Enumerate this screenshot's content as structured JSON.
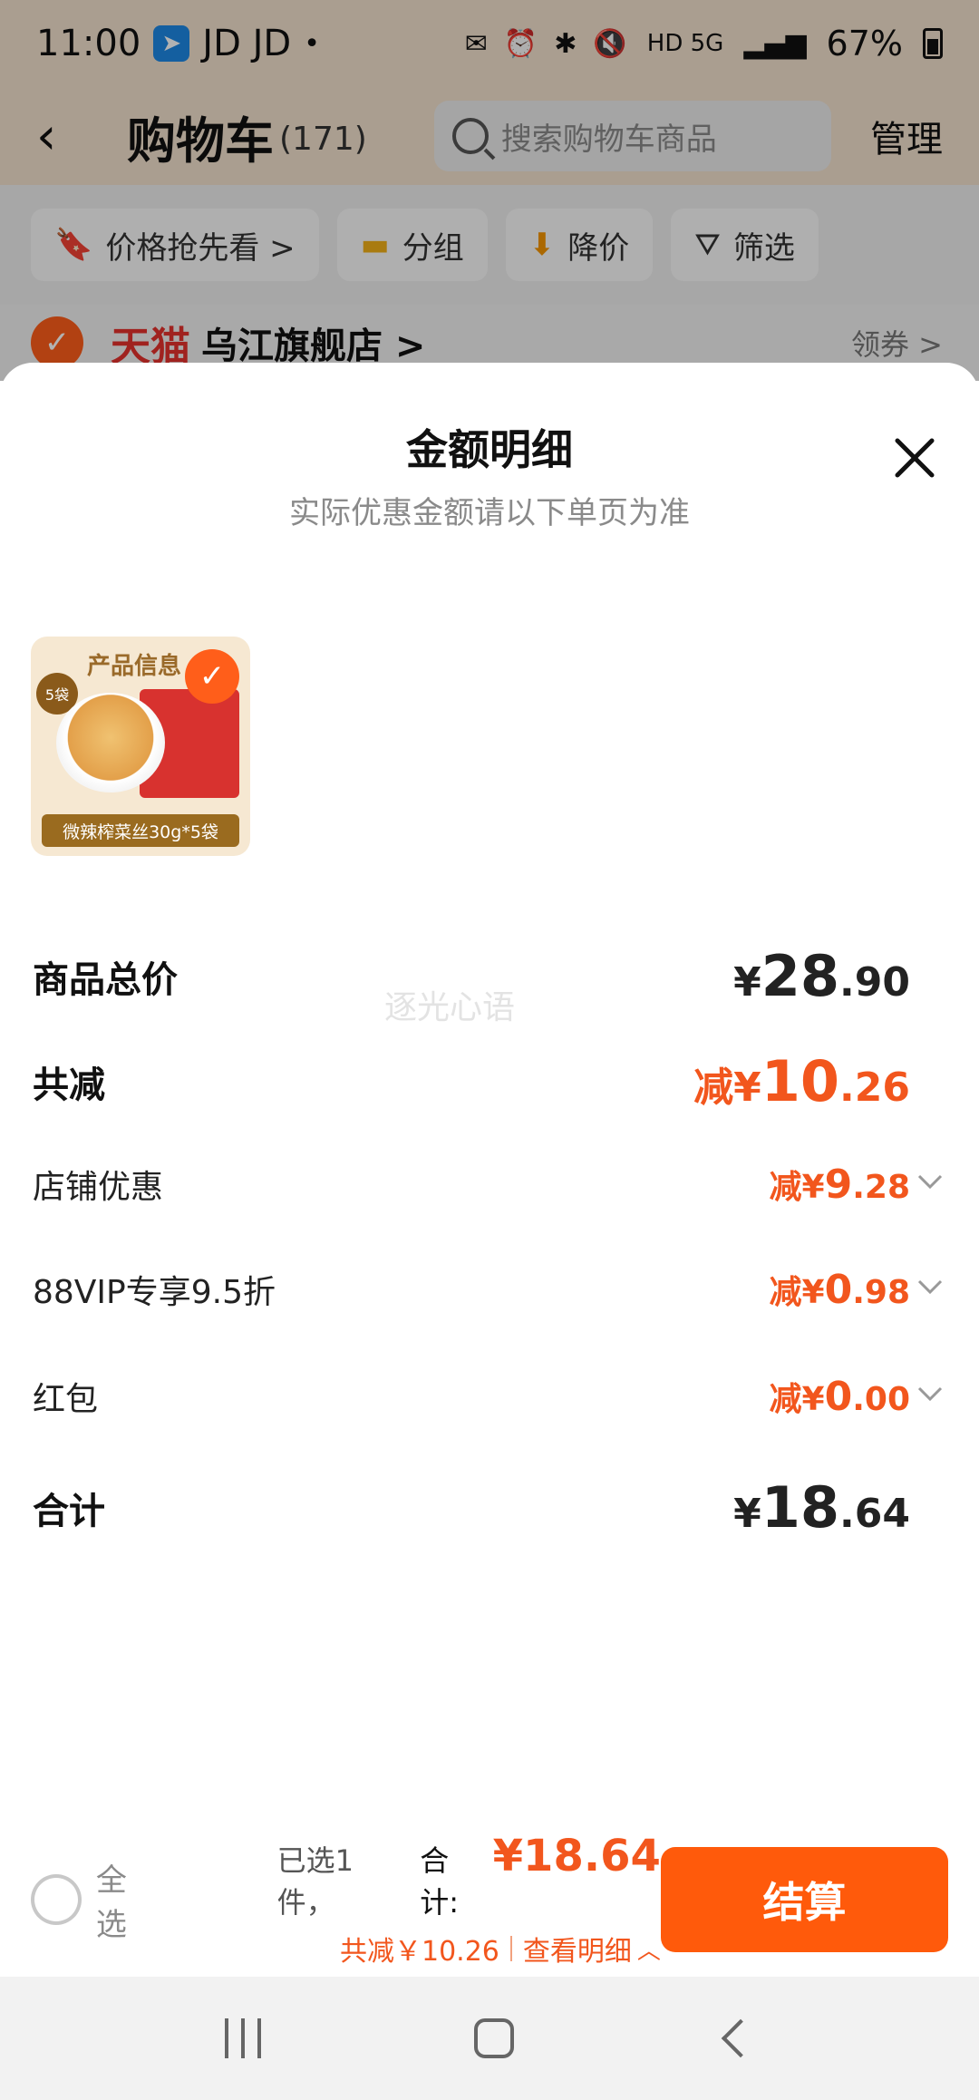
{
  "status_bar": {
    "time": "11:00",
    "app_labels": "JD JD",
    "dot": "•",
    "network": "HD 5G",
    "battery_pct": "67%"
  },
  "header": {
    "title": "购物车",
    "count": "(171)",
    "search_placeholder": "搜索购物车商品",
    "manage": "管理"
  },
  "filters": [
    {
      "label": "价格抢先看 >",
      "icon": "price-tag-icon"
    },
    {
      "label": "分组",
      "icon": "folder-icon"
    },
    {
      "label": "降价",
      "icon": "down-arrow-icon"
    },
    {
      "label": "筛选",
      "icon": "filter-icon"
    }
  ],
  "store": {
    "platform_logo": "天猫",
    "name": "乌江旗舰店 >",
    "coupon": "领券 >"
  },
  "sheet": {
    "title": "金额明细",
    "subtitle": "实际优惠金额请以下单页为准",
    "watermark": "逐光心语",
    "product": {
      "title": "产品信息",
      "badge": "5袋",
      "label": "微辣榨菜丝30g*5袋"
    },
    "rows": {
      "subtotal": {
        "label": "商品总价",
        "currency": "¥",
        "int": "28",
        "dec": ".90"
      },
      "discount_total": {
        "label": "共减",
        "prefix": "减¥",
        "int": "10",
        "dec": ".26"
      },
      "store_discount": {
        "label": "店铺优惠",
        "prefix": "减¥",
        "int": "9",
        "dec": ".28"
      },
      "vip_discount": {
        "label": "88VIP专享9.5折",
        "prefix": "减¥",
        "int": "0",
        "dec": ".98"
      },
      "red_packet": {
        "label": "红包",
        "prefix": "减¥",
        "int": "0",
        "dec": ".00"
      },
      "total": {
        "label": "合计",
        "currency": "¥",
        "int": "18",
        "dec": ".64"
      }
    }
  },
  "action_bar": {
    "select_all": "全选",
    "selected_count": "已选1件，",
    "total_label": "合计:",
    "total_value": "¥18.64",
    "discount_text": "共减￥10.26",
    "view_details": "查看明细",
    "checkout": "结算"
  },
  "colors": {
    "accent": "#ff5a0b",
    "discount": "#f2561d"
  }
}
